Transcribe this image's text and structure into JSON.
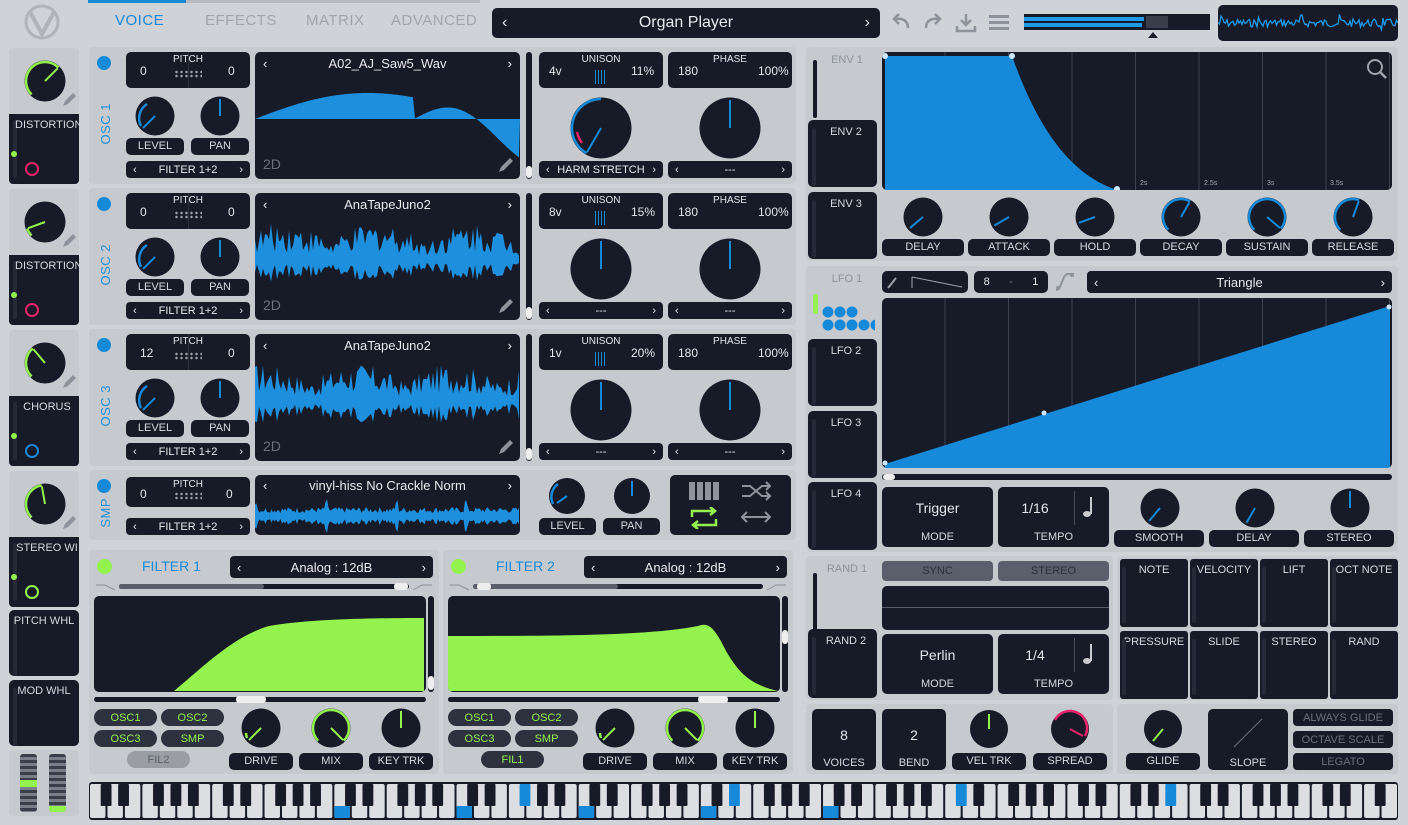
{
  "header": {
    "tabs": [
      "VOICE",
      "EFFECTS",
      "MATRIX",
      "ADVANCED"
    ],
    "active_tab": "VOICE",
    "preset_name": "Organ Player"
  },
  "colors": {
    "accent": "#1689d8",
    "green": "#94f24f",
    "dark": "#171a27",
    "panel": "#c6c9ce",
    "pink": "#e9246a"
  },
  "fx_slots": [
    {
      "label": "DISTORTION",
      "indicator": "red"
    },
    {
      "label": "DISTORTION",
      "indicator": "red"
    },
    {
      "label": "CHORUS",
      "indicator": "blue"
    },
    {
      "label": "STEREO WI",
      "indicator": "green"
    }
  ],
  "wheels": {
    "pitch": "PITCH WHL",
    "mod": "MOD WHL"
  },
  "oscillators": [
    {
      "name": "OSC 1",
      "pitch_l": "0",
      "pitch_label": "PITCH",
      "pitch_r": "0",
      "level": "LEVEL",
      "pan": "PAN",
      "route": "FILTER 1+2",
      "wave": "A02_AJ_Saw5_Wav",
      "dim": "2D",
      "unison_voices": "4v",
      "unison_label": "UNISON",
      "unison_detune": "11%",
      "phase": "180",
      "phase_label": "PHASE",
      "phase_rand": "100%",
      "sel_l": "HARM STRETCH",
      "sel_r": "---"
    },
    {
      "name": "OSC 2",
      "pitch_l": "0",
      "pitch_label": "PITCH",
      "pitch_r": "0",
      "level": "LEVEL",
      "pan": "PAN",
      "route": "FILTER 1+2",
      "wave": "AnaTapeJuno2",
      "dim": "2D",
      "unison_voices": "8v",
      "unison_label": "UNISON",
      "unison_detune": "15%",
      "phase": "180",
      "phase_label": "PHASE",
      "phase_rand": "100%",
      "sel_l": "---",
      "sel_r": "---"
    },
    {
      "name": "OSC 3",
      "pitch_l": "12",
      "pitch_label": "PITCH",
      "pitch_r": "0",
      "level": "LEVEL",
      "pan": "PAN",
      "route": "FILTER 1+2",
      "wave": "AnaTapeJuno2",
      "dim": "2D",
      "unison_voices": "1v",
      "unison_label": "UNISON",
      "unison_detune": "20%",
      "phase": "180",
      "phase_label": "PHASE",
      "phase_rand": "100%",
      "sel_l": "---",
      "sel_r": "---"
    }
  ],
  "sample": {
    "name": "SMP",
    "pitch_l": "0",
    "pitch_label": "PITCH",
    "pitch_r": "0",
    "route": "FILTER 1+2",
    "wave": "vinyl-hiss No Crackle Norm",
    "level": "LEVEL",
    "pan": "PAN"
  },
  "filters": [
    {
      "title": "FILTER 1",
      "model": "Analog : 12dB",
      "src": [
        "OSC1",
        "OSC2",
        "OSC3",
        "SMP"
      ],
      "link": "FIL2",
      "drive": "DRIVE",
      "mix": "MIX",
      "key": "KEY TRK"
    },
    {
      "title": "FILTER 2",
      "model": "Analog : 12dB",
      "src": [
        "OSC1",
        "OSC2",
        "OSC3",
        "SMP"
      ],
      "link": "FIL1",
      "drive": "DRIVE",
      "mix": "MIX",
      "key": "KEY TRK"
    }
  ],
  "envelopes": {
    "tabs": [
      "ENV 1",
      "ENV 2",
      "ENV 3"
    ],
    "time_marks": [
      "2s",
      "2.5s",
      "3s",
      "3.5s"
    ],
    "knobs": [
      "DELAY",
      "ATTACK",
      "HOLD",
      "DECAY",
      "SUSTAIN",
      "RELEASE"
    ]
  },
  "lfos": {
    "tabs": [
      "LFO 1",
      "LFO 2",
      "LFO 3",
      "LFO 4"
    ],
    "grid_l": "8",
    "grid_sep": "-",
    "grid_r": "1",
    "shape": "Triangle",
    "mode_value": "Trigger",
    "mode_label": "MODE",
    "tempo_value": "1/16",
    "tempo_label": "TEMPO",
    "knobs": [
      "SMOOTH",
      "DELAY",
      "STEREO"
    ]
  },
  "randoms": {
    "tabs": [
      "RAND 1",
      "RAND 2"
    ],
    "sync": "SYNC",
    "stereo": "STEREO",
    "mode_value": "Perlin",
    "mode_label": "MODE",
    "tempo_value": "1/4",
    "tempo_label": "TEMPO"
  },
  "mod_sources": [
    "NOTE",
    "VELOCITY",
    "LIFT",
    "OCT NOTE",
    "PRESSURE",
    "SLIDE",
    "STEREO",
    "RAND"
  ],
  "voice": {
    "voices": "8",
    "voices_label": "VOICES",
    "bend": "2",
    "bend_label": "BEND",
    "vel_trk": "VEL TRK",
    "spread": "SPREAD",
    "glide": "GLIDE",
    "slope": "SLOPE",
    "always_glide": "ALWAYS GLIDE",
    "octave_scale": "OCTAVE SCALE",
    "legato": "LEGATO"
  }
}
